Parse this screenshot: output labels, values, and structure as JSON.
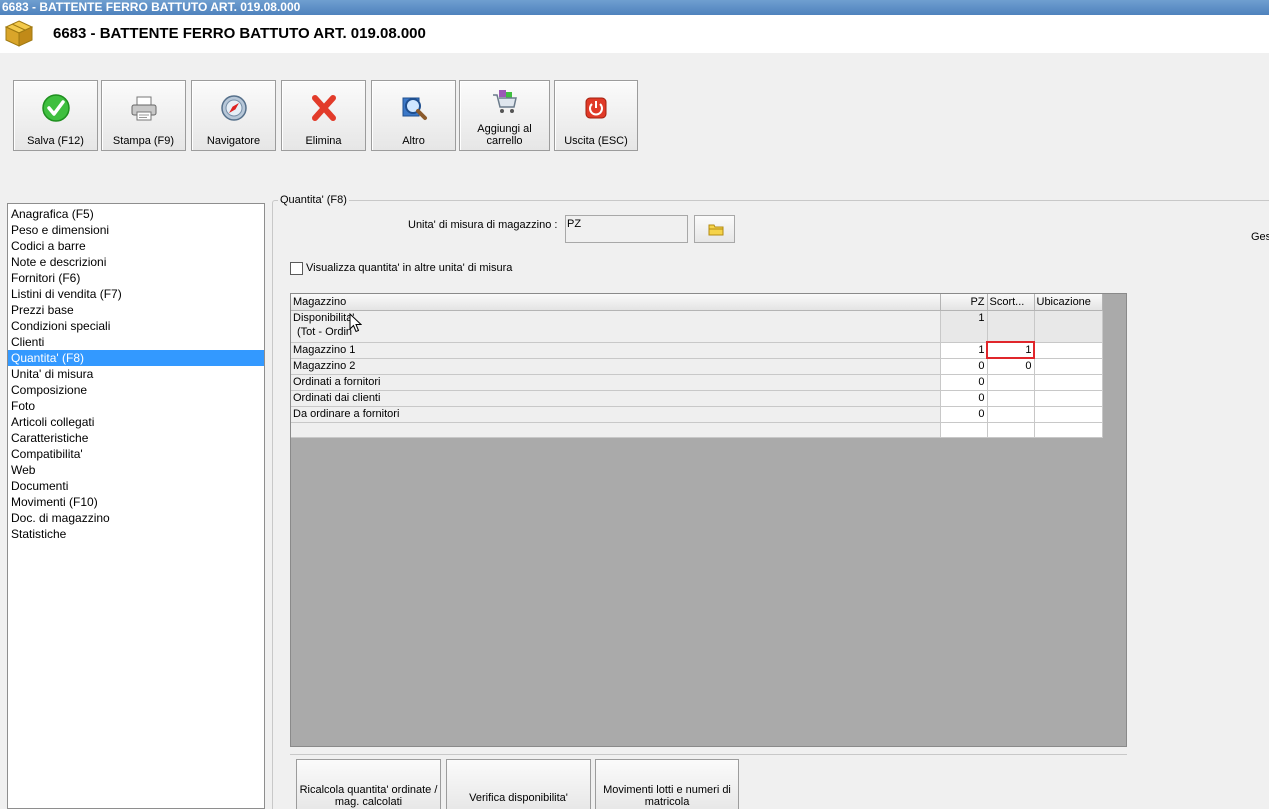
{
  "window": {
    "title": "6683 - BATTENTE FERRO BATTUTO ART. 019.08.000"
  },
  "header": {
    "title": "6683 - BATTENTE FERRO BATTUTO ART. 019.08.000"
  },
  "toolbar": {
    "buttons": [
      {
        "label": "Salva (F12)",
        "icon": "check-icon"
      },
      {
        "label": "Stampa (F9)",
        "icon": "printer-icon"
      },
      {
        "label": "Navigatore",
        "icon": "compass-icon"
      },
      {
        "label": "Elimina",
        "icon": "delete-x-icon"
      },
      {
        "label": "Altro",
        "icon": "magnifier-icon"
      },
      {
        "label": "Aggiungi al carrello",
        "icon": "cart-icon"
      },
      {
        "label": "Uscita (ESC)",
        "icon": "power-icon"
      }
    ]
  },
  "sidebar": {
    "items": [
      {
        "label": "Anagrafica (F5)"
      },
      {
        "label": "Peso e dimensioni"
      },
      {
        "label": "Codici a barre"
      },
      {
        "label": "Note e descrizioni"
      },
      {
        "label": "Fornitori (F6)"
      },
      {
        "label": "Listini di vendita (F7)"
      },
      {
        "label": "Prezzi base"
      },
      {
        "label": "Condizioni speciali"
      },
      {
        "label": "Clienti"
      },
      {
        "label": "Quantita' (F8)",
        "selected": true
      },
      {
        "label": "Unita' di misura"
      },
      {
        "label": "Composizione"
      },
      {
        "label": "Foto"
      },
      {
        "label": "Articoli collegati"
      },
      {
        "label": "Caratteristiche"
      },
      {
        "label": "Compatibilita'"
      },
      {
        "label": "Web"
      },
      {
        "label": "Documenti"
      },
      {
        "label": "Movimenti (F10)"
      },
      {
        "label": "Doc. di magazzino"
      },
      {
        "label": "Statistiche"
      }
    ]
  },
  "quantity": {
    "group_title": "Quantita' (F8)",
    "uom_label": "Unita' di misura di magazzino :",
    "uom_value": "PZ",
    "truncated_label": "Ges",
    "show_other_units_label": "Visualizza quantita' in altre unita' di misura",
    "show_other_units_checked": false,
    "grid": {
      "columns": [
        "Magazzino",
        "PZ",
        "Scort...",
        "Ubicazione"
      ],
      "rows": [
        {
          "name": "Disponibilita'",
          "name2": "(Tot - Ordin",
          "pz": "1",
          "scorta": "",
          "ubicazione": ""
        },
        {
          "name": "Magazzino 1",
          "pz": "1",
          "scorta": "1",
          "ubicazione": ""
        },
        {
          "name": "Magazzino 2",
          "pz": "0",
          "scorta": "0",
          "ubicazione": ""
        },
        {
          "name": "Ordinati a fornitori",
          "pz": "0",
          "scorta": "",
          "ubicazione": ""
        },
        {
          "name": "Ordinati dai clienti",
          "pz": "0",
          "scorta": "",
          "ubicazione": ""
        },
        {
          "name": "Da ordinare a fornitori",
          "pz": "0",
          "scorta": "",
          "ubicazione": ""
        }
      ]
    },
    "bottom_buttons": [
      {
        "label": "Ricalcola quantita' ordinate / mag. calcolati"
      },
      {
        "label": "Verifica disponibilita'"
      },
      {
        "label": "Movimenti lotti e numeri di matricola"
      }
    ]
  }
}
